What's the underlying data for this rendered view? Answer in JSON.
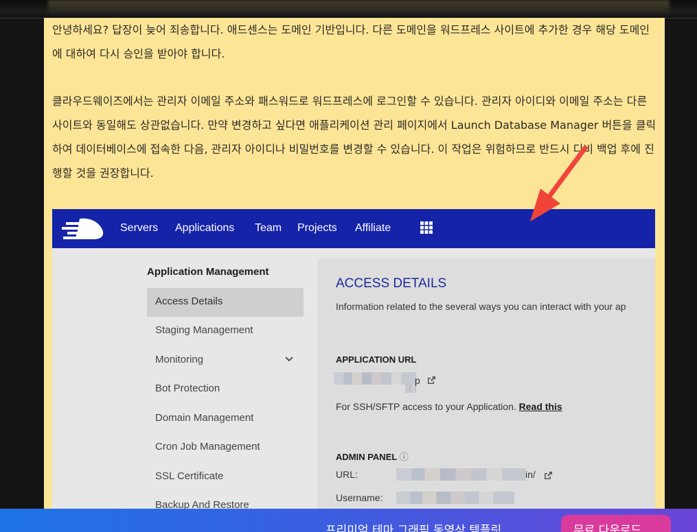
{
  "post": {
    "paragraph1": "안녕하세요? 답장이 늦어 죄송합니다. 애드센스는 도메인 기반입니다. 다른 도메인을 워드프레스 사이트에 추가한 경우 해당 도메인에 대하여 다시 승인을 받아야 합니다.",
    "paragraph2": "클라우드웨이즈에서는 관리자 이메일 주소와 패스워드로 워드프레스에 로그인할 수 있습니다. 관리자 아이디와 이메일 주소는 다른 사이트와 동일해도 상관없습니다. 만약 변경하고 싶다면 애플리케이션 관리 페이지에서 Launch Database Manager 버튼을 클릭하여 데이터베이스에 접속한 다음, 관리자 아이디나 비밀번호를 변경할 수 있습니다. 이 작업은 위험하므로 반드시 디비 백업 후에 진행할 것을 권장합니다."
  },
  "screenshot": {
    "nav": [
      "Servers",
      "Applications",
      "Team",
      "Projects",
      "Affiliate"
    ],
    "sidebar": {
      "title": "Application Management",
      "items": [
        "Access Details",
        "Staging Management",
        "Monitoring",
        "Bot Protection",
        "Domain Management",
        "Cron Job Management",
        "SSL Certificate",
        "Backup And Restore"
      ]
    },
    "content": {
      "title": "ACCESS DETAILS",
      "description": "Information related to the several ways you can interact with your ap",
      "app_url_label": "APPLICATION URL",
      "app_url_suffix": "p",
      "ssh_text": "For SSH/SFTP access to your Application.",
      "read_this": "Read this",
      "admin_panel_label": "ADMIN PANEL",
      "info_glyph": "ⓘ",
      "url_label": "URL:",
      "url_suffix": "in/",
      "username_label": "Username:"
    }
  },
  "banner": {
    "text": "프리미엄 테마 그래픽 동영상 템플릿",
    "button": "무료 다운로드"
  },
  "colors": {
    "note_bg": "#fde597",
    "nav_bg": "#1523a8",
    "arrow": "#f0443a",
    "title_blue": "#1c2a9b",
    "button_pink": "#d93b9c"
  }
}
